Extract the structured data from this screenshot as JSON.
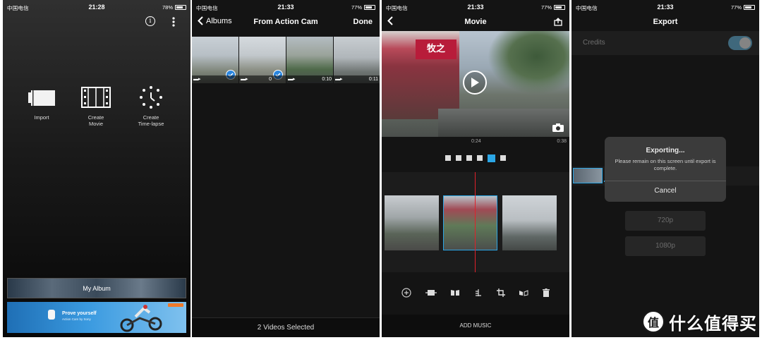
{
  "panels": {
    "home": {
      "status": {
        "carrier": "中国电信",
        "time": "21:28",
        "battery": "78%",
        "battery_level": 0.78
      },
      "tiles": [
        {
          "label": "Import",
          "icon": "import-icon"
        },
        {
          "label": "Create\nMovie",
          "icon": "film-strip-icon"
        },
        {
          "label": "Create\nTime-lapse",
          "icon": "time-lapse-icon"
        }
      ],
      "info_icon": "info-icon",
      "more_icon": "more-vertical-icon",
      "album_label": "My Album",
      "banner": {
        "title": "Prove yourself",
        "subtitle": "Action Cam by Sony"
      }
    },
    "picker": {
      "status": {
        "carrier": "中国电信",
        "time": "21:33",
        "battery": "77%",
        "battery_level": 0.77
      },
      "back_label": "Albums",
      "title": "From Action Cam",
      "done_label": "Done",
      "thumbnails": [
        {
          "duration": "",
          "selected": true
        },
        {
          "duration": "0",
          "selected": true
        },
        {
          "duration": "0:10",
          "selected": false
        },
        {
          "duration": "0:11",
          "selected": false
        }
      ],
      "footer": "2 Videos Selected"
    },
    "editor": {
      "status": {
        "carrier": "中国电信",
        "time": "21:33",
        "battery": "77%",
        "battery_level": 0.77
      },
      "title": "Movie",
      "current_time": "0:24",
      "total_time": "0:38",
      "page_dots": 6,
      "active_dot": 4,
      "sign_text": "牧之",
      "tools": [
        "add-icon",
        "trim-icon",
        "split-icon",
        "speed-icon",
        "crop-icon",
        "flip-icon",
        "trash-icon"
      ],
      "music_label": "ADD MUSIC"
    },
    "export": {
      "status": {
        "carrier": "中国电信",
        "time": "21:33",
        "battery": "77%",
        "battery_level": 0.77
      },
      "title": "Export",
      "credits_label": "Credits",
      "resolutions": [
        "720p",
        "1080p"
      ],
      "dialog": {
        "title": "Exporting...",
        "message": "Please remain on this screen until export is complete.",
        "cancel": "Cancel"
      }
    }
  },
  "watermark": {
    "text": "什么值得买",
    "logo_glyph": "值"
  },
  "colors": {
    "accent": "#2ba6e6",
    "playhead": "#e0202a",
    "check": "#2a86e0"
  }
}
